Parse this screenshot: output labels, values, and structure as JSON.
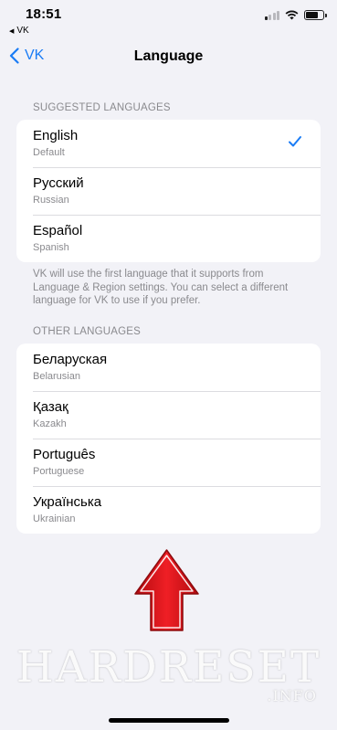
{
  "status_bar": {
    "time": "18:51",
    "back_app": "VK"
  },
  "nav": {
    "back_label": "VK",
    "title": "Language"
  },
  "suggested": {
    "header": "SUGGESTED LANGUAGES",
    "items": [
      {
        "name": "English",
        "sub": "Default",
        "selected": true
      },
      {
        "name": "Русский",
        "sub": "Russian",
        "selected": false
      },
      {
        "name": "Español",
        "sub": "Spanish",
        "selected": false
      }
    ],
    "footnote": "VK will use the first language that it supports from Language & Region settings. You can select a different language for VK to use if you prefer."
  },
  "other": {
    "header": "OTHER LANGUAGES",
    "items": [
      {
        "name": "Беларуская",
        "sub": "Belarusian"
      },
      {
        "name": "Қазақ",
        "sub": "Kazakh"
      },
      {
        "name": "Português",
        "sub": "Portuguese"
      },
      {
        "name": "Українська",
        "sub": "Ukrainian"
      }
    ]
  },
  "watermark": {
    "text": "HARDRESET",
    "sub": ".INFO"
  },
  "colors": {
    "accent": "#1a7cf5",
    "arrow": "#e0141b",
    "background": "#f2f2f7"
  },
  "icons": [
    "back-app-icon",
    "signal-icon",
    "wifi-icon",
    "battery-icon",
    "chevron-left-icon",
    "checkmark-icon",
    "arrow-up-icon"
  ]
}
